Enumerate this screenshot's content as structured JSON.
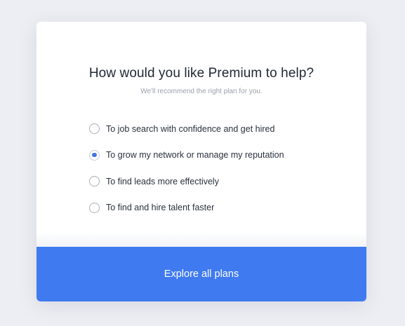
{
  "modal": {
    "title": "How would you like Premium to help?",
    "subtitle": "We'll recommend the right plan for you.",
    "options": [
      {
        "label": "To job search with confidence and get hired",
        "selected": false
      },
      {
        "label": "To grow my network or manage my reputation",
        "selected": true
      },
      {
        "label": "To find leads more effectively",
        "selected": false
      },
      {
        "label": "To find and hire talent faster",
        "selected": false
      }
    ],
    "cta_label": "Explore all plans"
  },
  "colors": {
    "accent": "#3f7af0",
    "radio_selected": "#3f74e6",
    "background": "#eceef3"
  }
}
